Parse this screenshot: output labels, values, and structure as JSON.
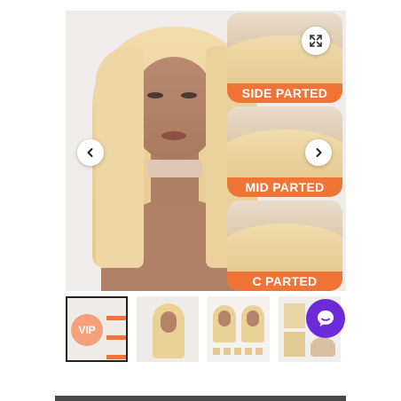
{
  "gallery": {
    "panels": [
      {
        "label": "SIDE PARTED"
      },
      {
        "label": "MID PARTED"
      },
      {
        "label": "C PARTED"
      }
    ],
    "expand_icon": "expand-arrows-icon",
    "prev_icon": "chevron-left-icon",
    "next_icon": "chevron-right-icon"
  },
  "thumbnails": {
    "vip_label": "VIP",
    "items": [
      {
        "name": "thumbnail-parting-options",
        "selected": true
      },
      {
        "name": "thumbnail-model-front",
        "selected": false
      },
      {
        "name": "thumbnail-model-details",
        "selected": false
      },
      {
        "name": "thumbnail-product-info",
        "selected": false
      }
    ]
  },
  "chat": {
    "icon": "chat-bubble-icon"
  },
  "colors": {
    "accent": "#f07436",
    "chat": "#6c2bd9"
  }
}
